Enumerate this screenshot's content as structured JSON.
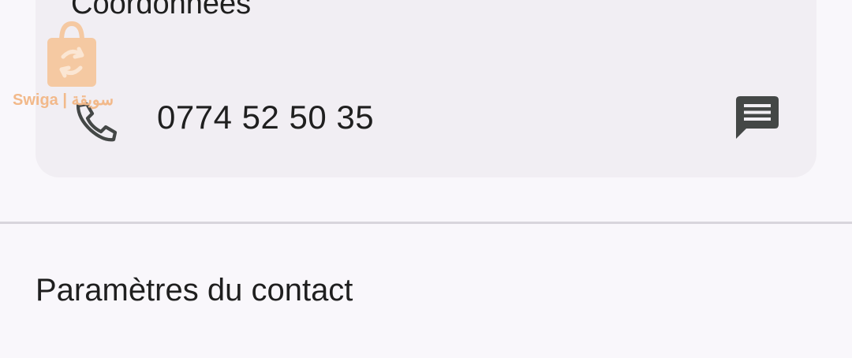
{
  "contact_card": {
    "section_title": "Coordonnées",
    "phone_number": "0774 52 50 35",
    "phone_icon": "phone-icon",
    "message_icon": "message-icon"
  },
  "watermark": {
    "logo_icon": "shopping-bag-logo-icon",
    "text": "Swiga | سويقة",
    "color": "#f2b98a"
  },
  "settings": {
    "title": "Paramètres du contact"
  },
  "colors": {
    "background": "#f9f7fb",
    "card": "#f1eef3",
    "divider": "#d8d5dc",
    "text": "#1f1f1f",
    "icon": "#444746"
  }
}
